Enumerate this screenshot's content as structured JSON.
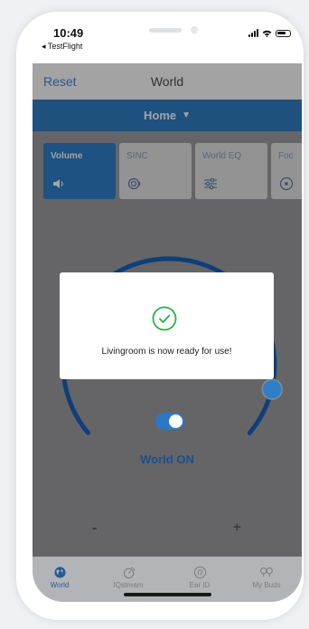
{
  "status": {
    "time": "10:49",
    "back_app": "◂ TestFlight"
  },
  "header": {
    "reset": "Reset",
    "title": "World"
  },
  "home_selector": {
    "label": "Home",
    "caret": "▼"
  },
  "tiles": [
    {
      "label": "Volume",
      "icon": "speaker-icon",
      "active": true
    },
    {
      "label": "SINC",
      "icon": "sinc-icon",
      "active": false
    },
    {
      "label": "World EQ",
      "icon": "equalizer-icon",
      "active": false
    },
    {
      "label": "Foc",
      "icon": "focus-icon",
      "active": false
    }
  ],
  "volume_dial": {
    "minus": "-",
    "plus": "+",
    "level": 0.9
  },
  "world_toggle": {
    "label": "World ON",
    "on": true
  },
  "dialog": {
    "message": "Livingroom is now ready for use!",
    "icon": "check-circle-icon"
  },
  "bottom_nav": [
    {
      "label": "World",
      "icon": "globe-icon",
      "active": true
    },
    {
      "label": "IQstream",
      "icon": "iqstream-icon",
      "active": false
    },
    {
      "label": "Ear ID",
      "icon": "ear-id-icon",
      "active": false
    },
    {
      "label": "My Buds",
      "icon": "buds-icon",
      "active": false
    }
  ],
  "colors": {
    "accent": "#2f7fc6",
    "dark_blue": "#17508f",
    "success": "#2dad4a"
  }
}
